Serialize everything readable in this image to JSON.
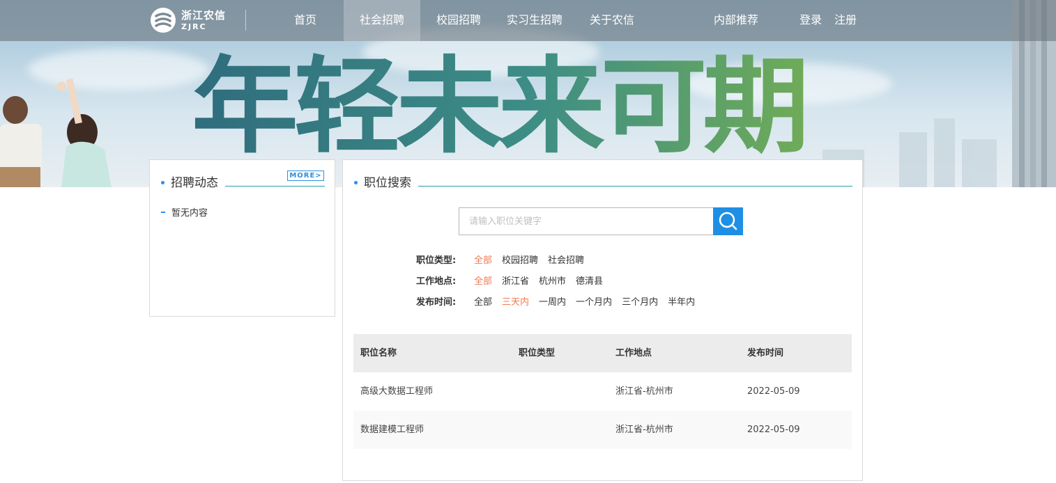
{
  "brand": {
    "name_cn": "浙江农信",
    "name_en": "ZJRC"
  },
  "nav": {
    "items": [
      {
        "label": "首页"
      },
      {
        "label": "社会招聘"
      },
      {
        "label": "校园招聘"
      },
      {
        "label": "实习生招聘"
      },
      {
        "label": "关于农信"
      }
    ],
    "active": "社会招聘",
    "referral": "内部推荐",
    "login": "登录",
    "register": "注册"
  },
  "hero": {
    "slogan": "年轻未来可期"
  },
  "news": {
    "title": "招聘动态",
    "more": "MORE>",
    "empty": "暂无内容"
  },
  "search": {
    "title": "职位搜索",
    "placeholder": "请输入职位关键字",
    "button_icon": "search-icon"
  },
  "filters": [
    {
      "label": "职位类型:",
      "options": [
        "全部",
        "校园招聘",
        "社会招聘"
      ],
      "selected": "全部"
    },
    {
      "label": "工作地点:",
      "options": [
        "全部",
        "浙江省",
        "杭州市",
        "德清县"
      ],
      "selected": "全部"
    },
    {
      "label": "发布时间:",
      "options": [
        "全部",
        "三天内",
        "一周内",
        "一个月内",
        "三个月内",
        "半年内"
      ],
      "selected": "三天内"
    }
  ],
  "jobs": {
    "columns": [
      "职位名称",
      "职位类型",
      "工作地点",
      "发布时间"
    ],
    "rows": [
      {
        "name": "高级大数据工程师",
        "type": "",
        "location": "浙江省-杭州市",
        "date": "2022-05-09"
      },
      {
        "name": "数据建模工程师",
        "type": "",
        "location": "浙江省-杭州市",
        "date": "2022-05-09"
      }
    ]
  },
  "colors": {
    "accent": "#1f8fe5",
    "selected_filter": "#ef7a4f",
    "section_line": "#2aa0a6"
  }
}
